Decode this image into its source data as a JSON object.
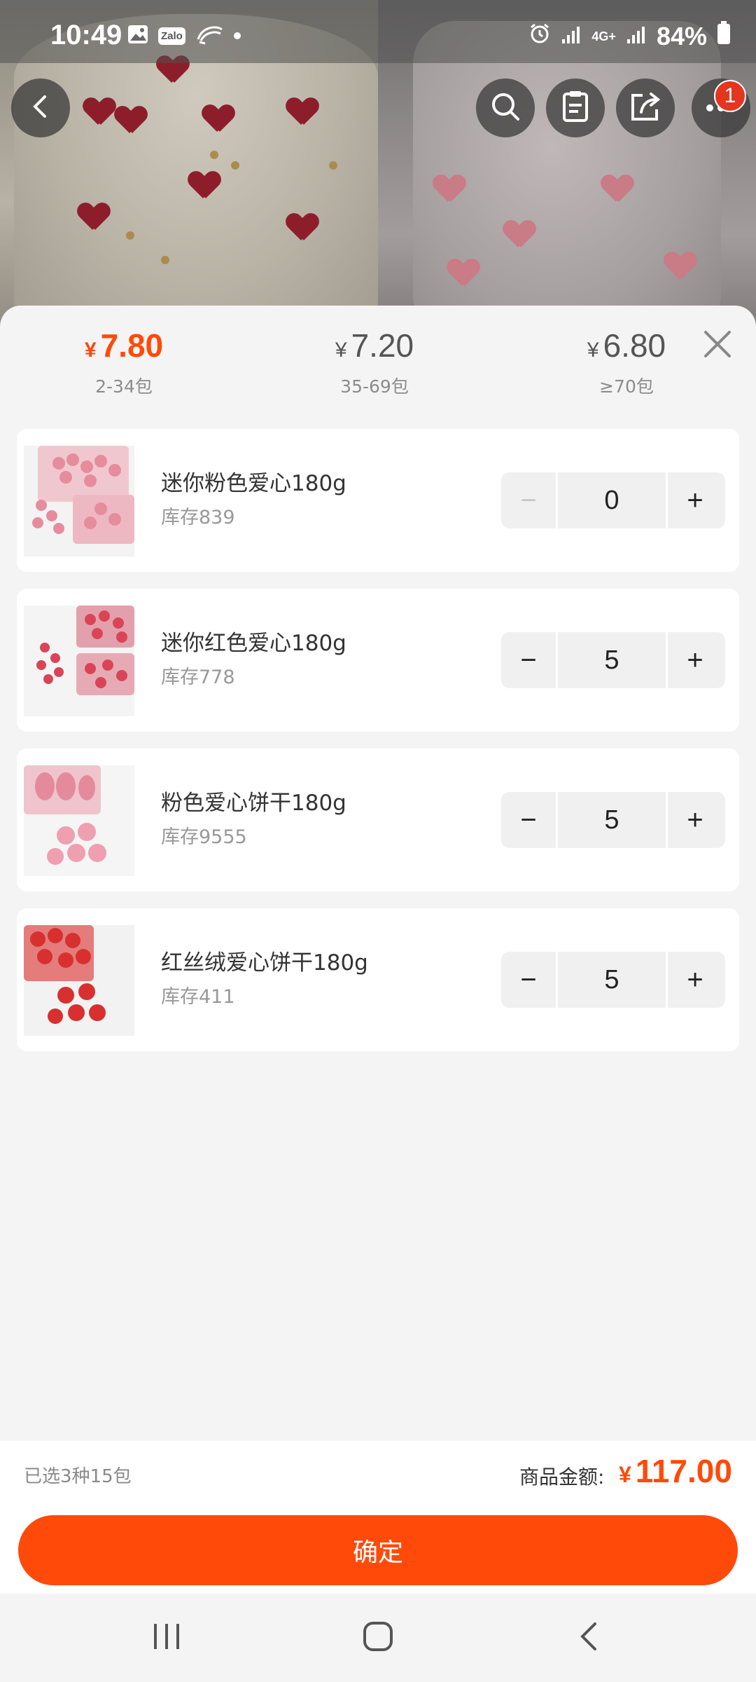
{
  "status_bar": {
    "time": "10:49",
    "notification_icons": [
      "image-icon",
      "zalo-icon",
      "shrimp-icon",
      "dot-icon"
    ],
    "zalo_label": "Zalo",
    "network": "4G+",
    "battery": "84%"
  },
  "header": {
    "icons": [
      "back-icon",
      "search-icon",
      "clipboard-icon",
      "share-icon",
      "more-icon"
    ],
    "cart_badge": "1"
  },
  "price_tiers": [
    {
      "price": "7.80",
      "range": "2-34包",
      "active": true
    },
    {
      "price": "7.20",
      "range": "35-69包",
      "active": false
    },
    {
      "price": "6.80",
      "range": "≥70包",
      "active": false
    }
  ],
  "currency": "¥",
  "items": [
    {
      "name": "迷你粉色爱心180g",
      "stock": "库存839",
      "quantity": "0",
      "minus_disabled": true,
      "minus": "−",
      "plus": "+"
    },
    {
      "name": "迷你红色爱心180g",
      "stock": "库存778",
      "quantity": "5",
      "minus_disabled": false,
      "minus": "−",
      "plus": "+"
    },
    {
      "name": "粉色爱心饼干180g",
      "stock": "库存9555",
      "quantity": "5",
      "minus_disabled": false,
      "minus": "−",
      "plus": "+"
    },
    {
      "name": "红丝绒爱心饼干180g",
      "stock": "库存411",
      "quantity": "5",
      "minus_disabled": false,
      "minus": "−",
      "plus": "+"
    }
  ],
  "summary": {
    "selected_text": "已选3种15包",
    "total_label": "商品金额:",
    "total_value": "117.00"
  },
  "confirm_label": "确定",
  "colors": {
    "accent": "#ff4a0a",
    "badge": "#e4361f",
    "sheet_bg": "#f4f4f4"
  }
}
